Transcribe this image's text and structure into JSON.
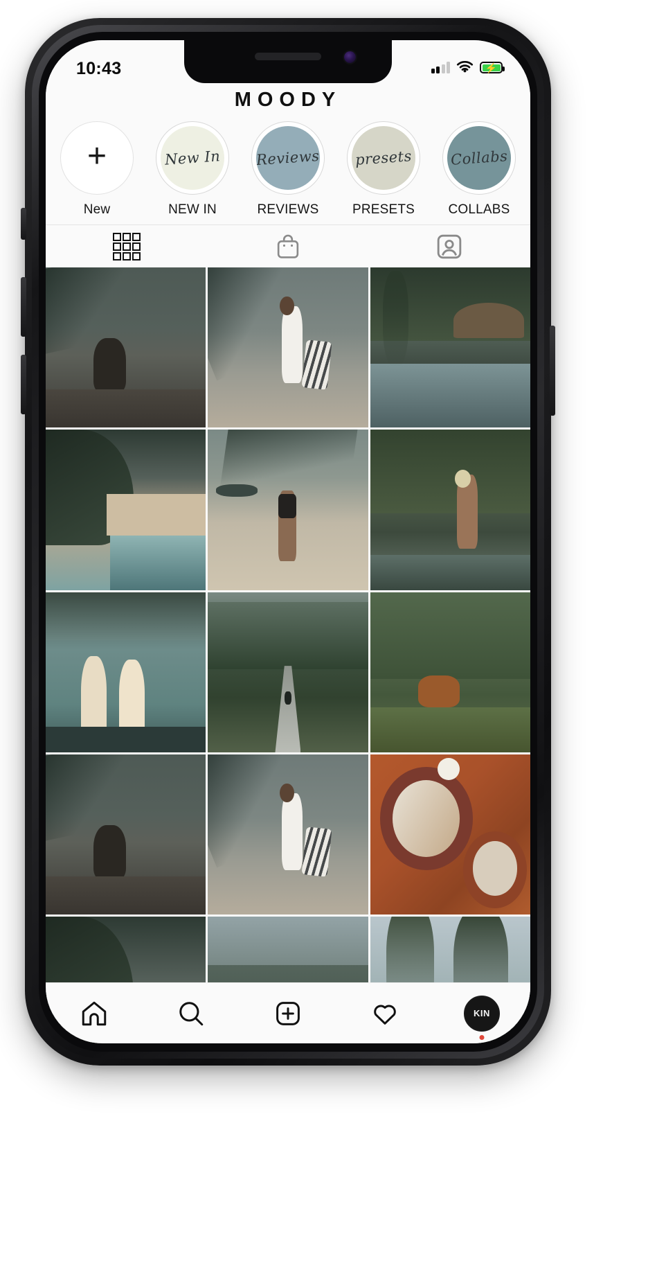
{
  "status_bar": {
    "time": "10:43",
    "signal_icon": "cellular-signal-icon",
    "wifi_icon": "wifi-icon",
    "battery_icon": "battery-charging-icon",
    "battery_color": "#3ad24a",
    "charging_glyph": "⚡"
  },
  "header": {
    "title": "MOODY"
  },
  "highlights": [
    {
      "label": "New",
      "script": "",
      "fill": "#ffffff",
      "is_add": true,
      "name": "highlight-new"
    },
    {
      "label": "NEW IN",
      "script": "New In",
      "fill": "#eef0e3",
      "is_add": false,
      "name": "highlight-new-in"
    },
    {
      "label": "REVIEWS",
      "script": "Reviews",
      "fill": "#94adb8",
      "is_add": false,
      "name": "highlight-reviews"
    },
    {
      "label": "PRESETS",
      "script": "presets",
      "fill": "#d6d6c8",
      "is_add": false,
      "name": "highlight-presets"
    },
    {
      "label": "COLLABS",
      "script": "Collabs",
      "fill": "#76949a",
      "is_add": false,
      "name": "highlight-collabs"
    }
  ],
  "profile_tabs": [
    {
      "icon": "grid-icon",
      "active": true,
      "name": "tab-grid"
    },
    {
      "icon": "shop-bag-icon",
      "active": false,
      "name": "tab-shop"
    },
    {
      "icon": "tagged-person-icon",
      "active": false,
      "name": "tab-tagged"
    }
  ],
  "grid": {
    "posts": [
      {
        "alt": "woman sitting on dark sand beach at dusk with palm frond",
        "name": "post-1"
      },
      {
        "alt": "woman in white swimsuit walking on beach with striped bag",
        "name": "post-2"
      },
      {
        "alt": "tropical resort pool with thatched roof villa and palms",
        "name": "post-3"
      },
      {
        "alt": "rocky cove with white sand beach and turquoise surf",
        "name": "post-4"
      },
      {
        "alt": "woman in black swimsuit on beach under palm leaves with longtail boat",
        "name": "post-5"
      },
      {
        "alt": "woman in black bikini kneeling by pool under palm trees",
        "name": "post-6"
      },
      {
        "alt": "two blonde women with braided hair looking at teal sea",
        "name": "post-7"
      },
      {
        "alt": "cyclist on road through jungle valley with green cliffs",
        "name": "post-8"
      },
      {
        "alt": "brown cow grazing in palm grove meadow",
        "name": "post-9"
      },
      {
        "alt": "woman sitting on dark sand beach at dusk with palm frond",
        "name": "post-10"
      },
      {
        "alt": "woman in white swimsuit walking on beach with striped bag",
        "name": "post-11"
      },
      {
        "alt": "acai smoothie bowls with kiwi and coconut flat lay",
        "name": "post-12"
      },
      {
        "alt": "rocky cove with white sand beach and turquoise surf",
        "name": "post-13"
      },
      {
        "alt": "sea cliff coastline partial view",
        "name": "post-14"
      },
      {
        "alt": "palm trees against pale sky partial view",
        "name": "post-15"
      }
    ]
  },
  "bottom_nav": [
    {
      "icon": "home-icon",
      "name": "nav-home",
      "active": true
    },
    {
      "icon": "search-icon",
      "name": "nav-search",
      "active": false
    },
    {
      "icon": "add-post-icon",
      "name": "nav-add",
      "active": false
    },
    {
      "icon": "heart-icon",
      "name": "nav-activity",
      "active": false
    },
    {
      "icon": "profile-avatar-icon",
      "name": "nav-profile",
      "active": true,
      "avatar_text": "KIN"
    }
  ]
}
